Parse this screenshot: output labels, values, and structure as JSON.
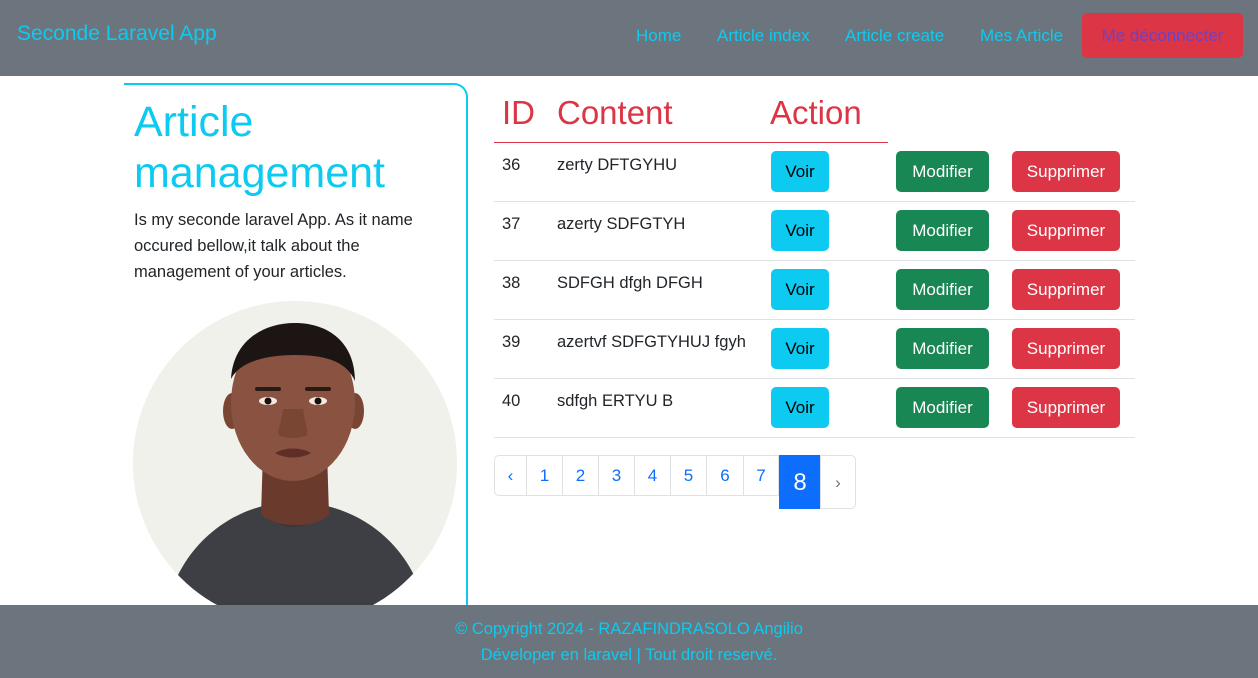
{
  "navbar": {
    "brand": "Seconde Laravel App",
    "links": [
      "Home",
      "Article index",
      "Article create",
      "Mes Article"
    ],
    "logout_label": "Me déconnecter"
  },
  "sidebar": {
    "title": "Article management",
    "description": "Is my seconde laravel App. As it name occured bellow,it talk about the management of your articles."
  },
  "table": {
    "headers": [
      "ID",
      "Content",
      "Action"
    ],
    "rows": [
      {
        "id": "36",
        "content": "zerty DFTGYHU"
      },
      {
        "id": "37",
        "content": "azerty SDFGTYH"
      },
      {
        "id": "38",
        "content": "SDFGH dfgh DFGH"
      },
      {
        "id": "39",
        "content": "azertvf SDFGTYHUJ fgyh"
      },
      {
        "id": "40",
        "content": "sdfgh ERTYU B"
      }
    ],
    "actions": {
      "view": "Voir",
      "edit": "Modifier",
      "delete": "Supprimer"
    }
  },
  "pagination": {
    "prev": "‹",
    "pages": [
      "1",
      "2",
      "3",
      "4",
      "5",
      "6",
      "7",
      "8"
    ],
    "current": "8",
    "next": "›"
  },
  "footer": {
    "line1": "© Copyright 2024 - RAZAFINDRASOLO Angilio",
    "line2": "Déveloper en laravel | Tout droit reservé."
  },
  "colors": {
    "navbar_bg": "#6c757d",
    "accent_cyan": "#0dcaf0",
    "danger": "#dc3545",
    "success": "#198754",
    "primary": "#0d6efd"
  }
}
